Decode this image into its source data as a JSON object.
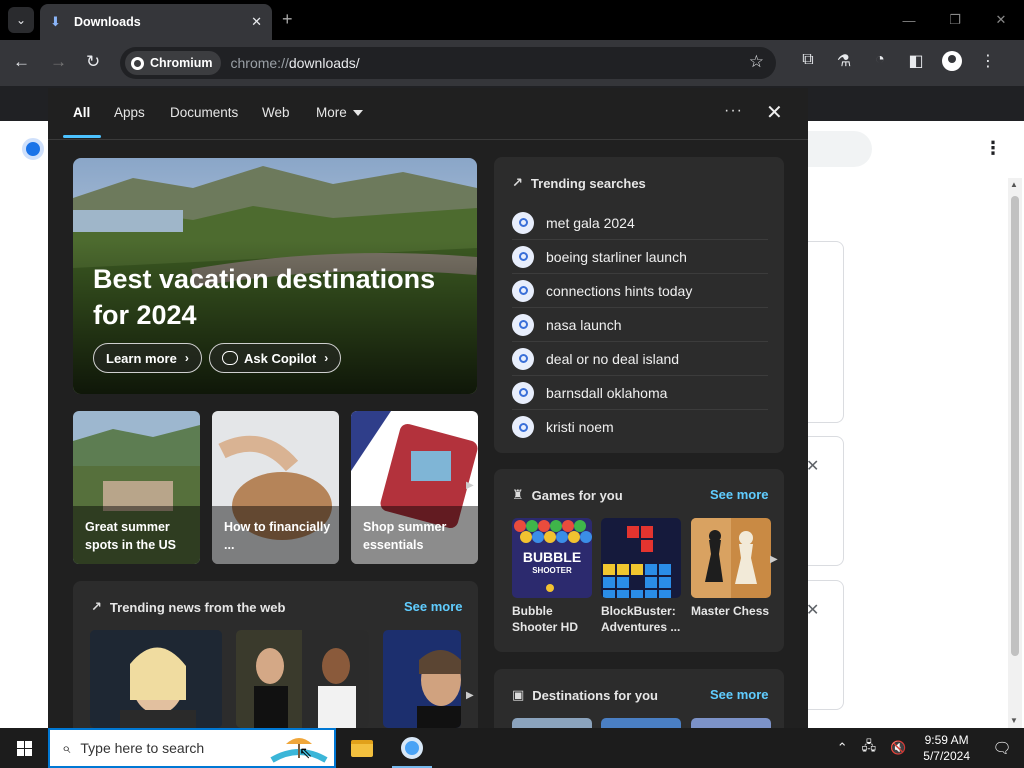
{
  "browser": {
    "tab_title": "Downloads",
    "chip_label": "Chromium",
    "url_scheme": "chrome://",
    "url_rest": "downloads/"
  },
  "flyout": {
    "tabs": [
      "All",
      "Apps",
      "Documents",
      "Web",
      "More"
    ],
    "hero": {
      "title": "Best vacation destinations for 2024",
      "learn_more": "Learn more",
      "ask_copilot": "Ask Copilot"
    },
    "tiles": [
      {
        "label": "Great summer spots in the US"
      },
      {
        "label": "How to financially ..."
      },
      {
        "label": "Shop summer essentials"
      }
    ],
    "trending_news": {
      "title": "Trending news from the web",
      "see_more": "See more"
    },
    "trending_searches": {
      "title": "Trending searches",
      "items": [
        "met gala 2024",
        "boeing starliner launch",
        "connections hints today",
        "nasa launch",
        "deal or no deal island",
        "barnsdall oklahoma",
        "kristi noem"
      ]
    },
    "games": {
      "title": "Games for you",
      "see_more": "See more",
      "items": [
        {
          "label": "Bubble Shooter HD"
        },
        {
          "label": "BlockBuster: Adventures ..."
        },
        {
          "label": "Master Chess"
        }
      ],
      "thumb_text": {
        "bubble": "BUBBLE",
        "shooter": "SHOOTER"
      }
    },
    "destinations": {
      "title": "Destinations for you",
      "see_more": "See more"
    }
  },
  "taskbar": {
    "search_placeholder": "Type here to search",
    "time": "9:59 AM",
    "date": "5/7/2024"
  }
}
